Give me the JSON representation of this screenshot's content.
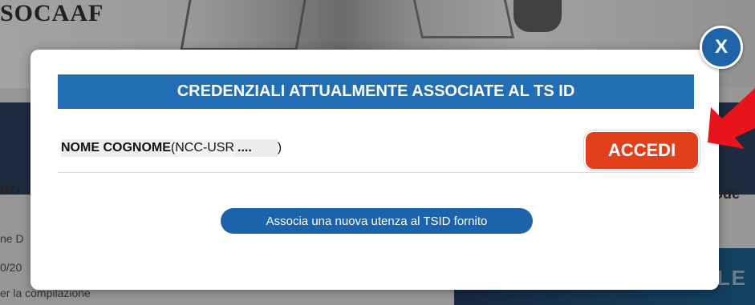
{
  "background": {
    "logo": "SOCAAF",
    "left_lines": [
      {
        "text": "azi"
      },
      {
        "text": "ne D"
      },
      {
        "text": "0/20"
      },
      {
        "text": "er la compilazione"
      }
    ],
    "right_text": "ode",
    "promo_text": "LE"
  },
  "modal": {
    "close_label": "X",
    "header": "CREDENZIALI ATTUALMENTE ASSOCIATE AL TS ID",
    "credential": {
      "name": "NOME COGNOME",
      "code_prefix": "(NCC-USR",
      "code_masked": "....",
      "code_suffix": ")"
    },
    "accedi_label": "ACCEDI",
    "associate_label": "Associa una nuova utenza al TSID fornito"
  },
  "colors": {
    "header_blue": "#226eb5",
    "button_blue": "#1c63ac",
    "accedi_red": "#e23f1c",
    "arrow_red": "#e8141c"
  }
}
